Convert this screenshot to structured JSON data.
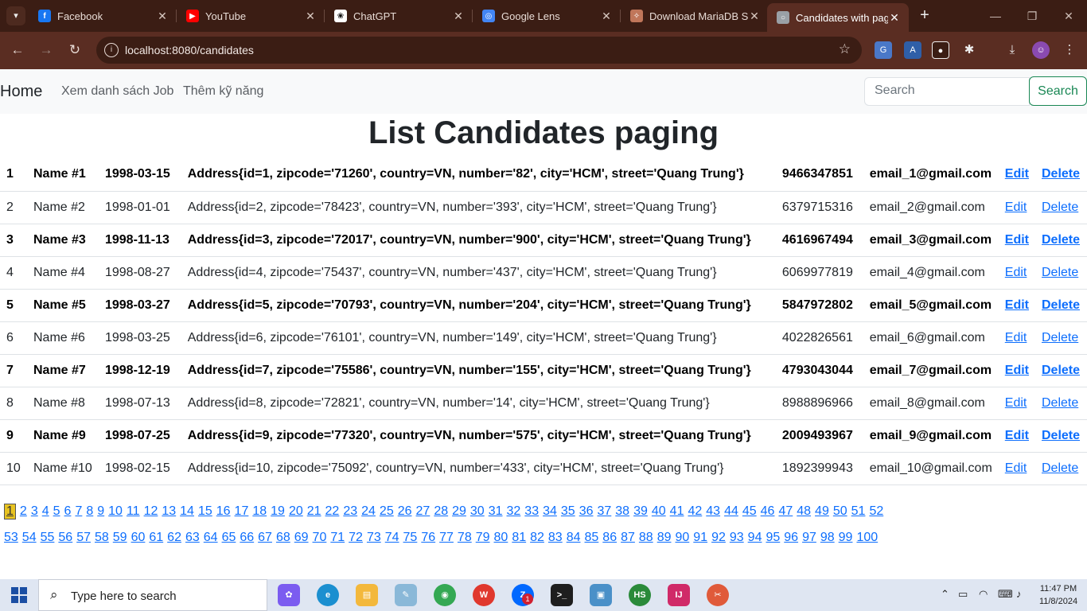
{
  "browser": {
    "tabs": [
      {
        "title": "Facebook",
        "icon": "facebook-icon",
        "color": "#1877f2"
      },
      {
        "title": "YouTube",
        "icon": "youtube-icon",
        "color": "#ff0000"
      },
      {
        "title": "ChatGPT",
        "icon": "chatgpt-icon",
        "color": "#ffffff"
      },
      {
        "title": "Google Lens",
        "icon": "google-lens-icon",
        "color": "#4285f4"
      },
      {
        "title": "Download MariaDB S",
        "icon": "mariadb-icon",
        "color": "#c0765a"
      },
      {
        "title": "Candidates with pagi",
        "icon": "globe-icon",
        "color": "#9aa0a6"
      }
    ],
    "url": "localhost:8080/candidates"
  },
  "navbar": {
    "brand": "Home",
    "links": [
      "Xem danh sách Job",
      "Thêm kỹ năng"
    ],
    "search_placeholder": "Search",
    "search_button": "Search"
  },
  "page": {
    "title": "List Candidates paging"
  },
  "candidates": [
    {
      "id": "1",
      "name": "Name #1",
      "dob": "1998-03-15",
      "address": "Address{id=1, zipcode='71260', country=VN, number='82', city='HCM', street='Quang Trung'}",
      "phone": "9466347851",
      "email": "email_1@gmail.com",
      "edit": "Edit",
      "delete": "Delete"
    },
    {
      "id": "2",
      "name": "Name #2",
      "dob": "1998-01-01",
      "address": "Address{id=2, zipcode='78423', country=VN, number='393', city='HCM', street='Quang Trung'}",
      "phone": "6379715316",
      "email": "email_2@gmail.com",
      "edit": "Edit",
      "delete": "Delete"
    },
    {
      "id": "3",
      "name": "Name #3",
      "dob": "1998-11-13",
      "address": "Address{id=3, zipcode='72017', country=VN, number='900', city='HCM', street='Quang Trung'}",
      "phone": "4616967494",
      "email": "email_3@gmail.com",
      "edit": "Edit",
      "delete": "Delete"
    },
    {
      "id": "4",
      "name": "Name #4",
      "dob": "1998-08-27",
      "address": "Address{id=4, zipcode='75437', country=VN, number='437', city='HCM', street='Quang Trung'}",
      "phone": "6069977819",
      "email": "email_4@gmail.com",
      "edit": "Edit",
      "delete": "Delete"
    },
    {
      "id": "5",
      "name": "Name #5",
      "dob": "1998-03-27",
      "address": "Address{id=5, zipcode='70793', country=VN, number='204', city='HCM', street='Quang Trung'}",
      "phone": "5847972802",
      "email": "email_5@gmail.com",
      "edit": "Edit",
      "delete": "Delete"
    },
    {
      "id": "6",
      "name": "Name #6",
      "dob": "1998-03-25",
      "address": "Address{id=6, zipcode='76101', country=VN, number='149', city='HCM', street='Quang Trung'}",
      "phone": "4022826561",
      "email": "email_6@gmail.com",
      "edit": "Edit",
      "delete": "Delete"
    },
    {
      "id": "7",
      "name": "Name #7",
      "dob": "1998-12-19",
      "address": "Address{id=7, zipcode='75586', country=VN, number='155', city='HCM', street='Quang Trung'}",
      "phone": "4793043044",
      "email": "email_7@gmail.com",
      "edit": "Edit",
      "delete": "Delete"
    },
    {
      "id": "8",
      "name": "Name #8",
      "dob": "1998-07-13",
      "address": "Address{id=8, zipcode='72821', country=VN, number='14', city='HCM', street='Quang Trung'}",
      "phone": "8988896966",
      "email": "email_8@gmail.com",
      "edit": "Edit",
      "delete": "Delete"
    },
    {
      "id": "9",
      "name": "Name #9",
      "dob": "1998-07-25",
      "address": "Address{id=9, zipcode='77320', country=VN, number='575', city='HCM', street='Quang Trung'}",
      "phone": "2009493967",
      "email": "email_9@gmail.com",
      "edit": "Edit",
      "delete": "Delete"
    },
    {
      "id": "10",
      "name": "Name #10",
      "dob": "1998-02-15",
      "address": "Address{id=10, zipcode='75092', country=VN, number='433', city='HCM', street='Quang Trung'}",
      "phone": "1892399943",
      "email": "email_10@gmail.com",
      "edit": "Edit",
      "delete": "Delete"
    }
  ],
  "pagination": {
    "current_page": 1,
    "total_pages": 100,
    "split_after": 52,
    "current_color": "#e8c320"
  },
  "taskbar": {
    "search_placeholder": "Type here to search",
    "apps": [
      "copilot-icon",
      "edge-icon",
      "file-explorer-icon",
      "notepad-icon",
      "chrome-icon",
      "wps-icon",
      "zalo-icon",
      "terminal-icon",
      "remote-desktop-icon",
      "hs-icon",
      "intellij-icon",
      "snipping-tool-icon"
    ],
    "zalo_badge": "1",
    "time": "11:47 PM",
    "date": "11/8/2024"
  }
}
